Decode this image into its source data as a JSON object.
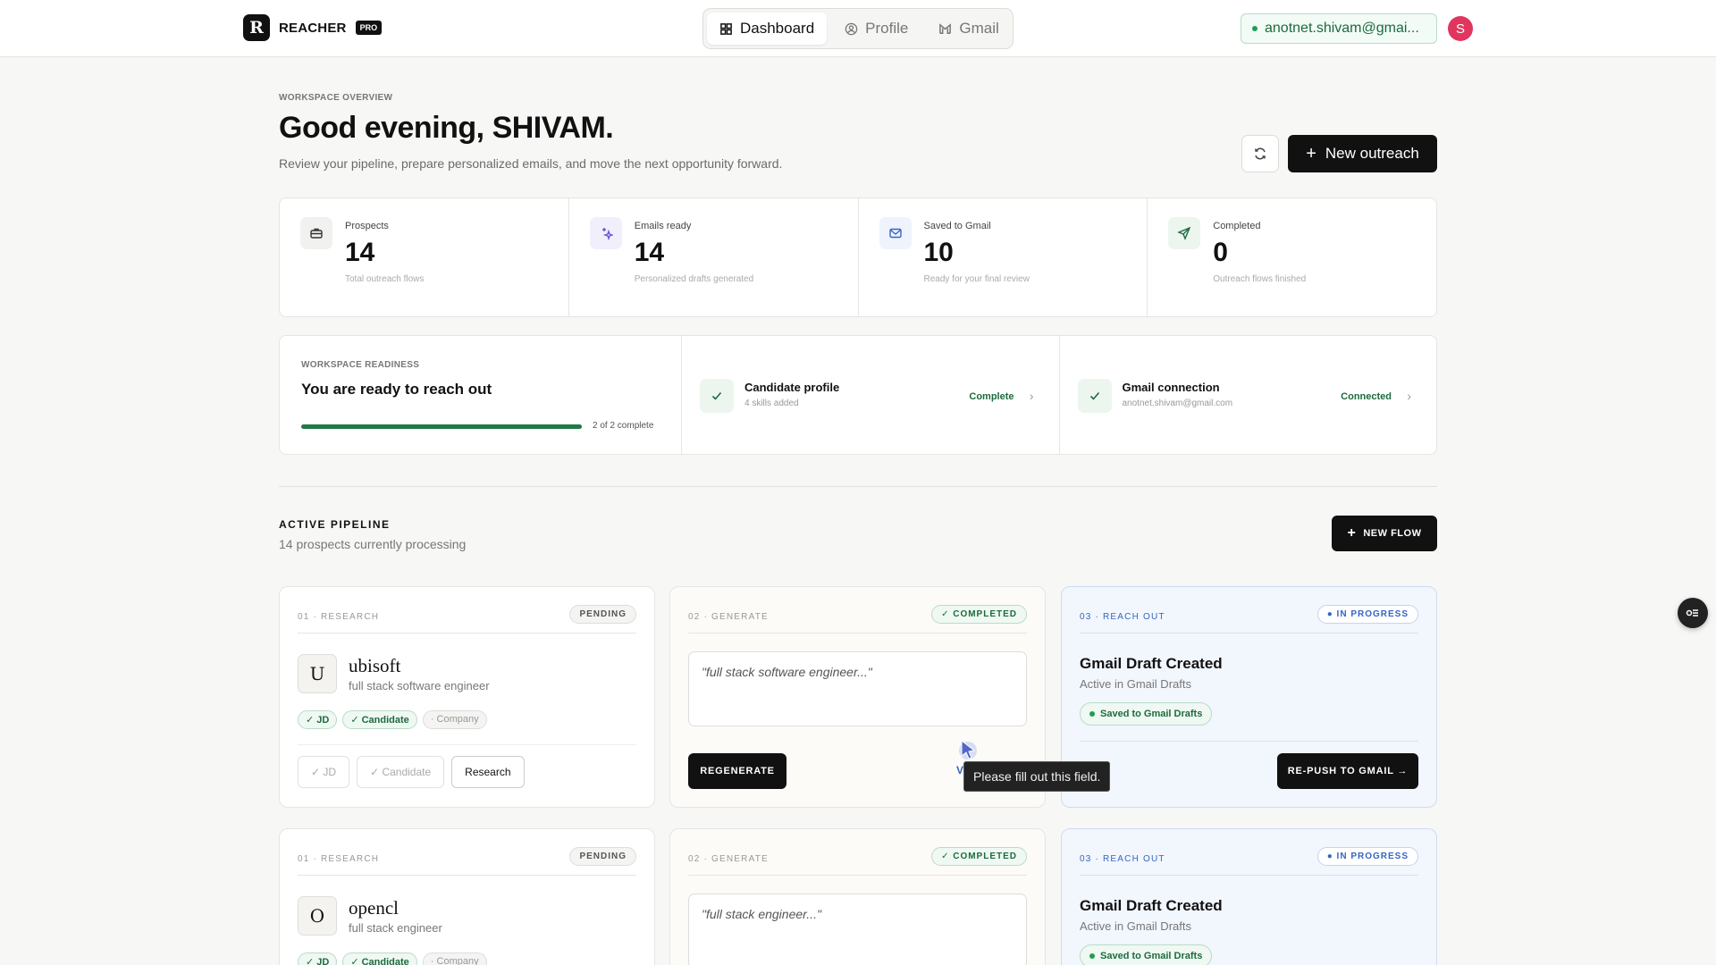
{
  "brand": {
    "logo_letter": "R",
    "name": "REACHER",
    "tier": "PRO"
  },
  "nav": {
    "tabs": [
      {
        "label": "Dashboard",
        "icon": "grid-icon"
      },
      {
        "label": "Profile",
        "icon": "user-circle-icon"
      },
      {
        "label": "Gmail",
        "icon": "gmail-icon"
      }
    ]
  },
  "account": {
    "email": "anotnet.shivam@gmai...",
    "avatar": "S"
  },
  "header": {
    "eyebrow": "WORKSPACE OVERVIEW",
    "greeting": "Good evening, SHIVAM.",
    "subtitle": "Review your pipeline, prepare personalized emails, and move the next opportunity forward.",
    "new_outreach": "New outreach"
  },
  "stats": [
    {
      "label": "Prospects",
      "value": "14",
      "sub": "Total outreach flows",
      "icon": "briefcase-icon"
    },
    {
      "label": "Emails ready",
      "value": "14",
      "sub": "Personalized drafts generated",
      "icon": "sparkle-icon"
    },
    {
      "label": "Saved to Gmail",
      "value": "10",
      "sub": "Ready for your final review",
      "icon": "mail-icon"
    },
    {
      "label": "Completed",
      "value": "0",
      "sub": "Outreach flows finished",
      "icon": "send-icon"
    }
  ],
  "readiness": {
    "eyebrow": "WORKSPACE READINESS",
    "title": "You are ready to reach out",
    "progress_text": "2 of 2 complete",
    "progress": 1.0,
    "items": [
      {
        "title": "Candidate profile",
        "sub": "4 skills added",
        "status": "Complete"
      },
      {
        "title": "Gmail connection",
        "sub": "anotnet.shivam@gmail.com",
        "status": "Connected"
      }
    ]
  },
  "pipeline": {
    "title": "ACTIVE PIPELINE",
    "subtitle": "14 prospects currently processing",
    "new_flow": "NEW FLOW",
    "rows": [
      {
        "research": {
          "step": "01 · RESEARCH",
          "badge": "PENDING",
          "initial": "U",
          "company": "ubisoft",
          "role": "full stack software engineer",
          "chips": [
            "✓ JD",
            "✓ Candidate",
            "· Company"
          ],
          "actions": [
            "✓ JD",
            "✓ Candidate",
            "Research"
          ]
        },
        "generate": {
          "step": "02 · GENERATE",
          "badge": "✓ COMPLETED",
          "quote": "\"full stack software engineer...\"",
          "regenerate": "REGENERATE",
          "view": "V"
        },
        "reach": {
          "step": "03 · REACH OUT",
          "badge": "● IN PROGRESS",
          "title": "Gmail Draft Created",
          "sub": "Active in Gmail Drafts",
          "pill": "Saved to Gmail Drafts",
          "repush": "RE-PUSH TO GMAIL →"
        }
      },
      {
        "research": {
          "step": "01 · RESEARCH",
          "badge": "PENDING",
          "initial": "O",
          "company": "opencl",
          "role": "full stack engineer",
          "chips": [
            "✓ JD",
            "✓ Candidate",
            "· Company"
          ]
        },
        "generate": {
          "step": "02 · GENERATE",
          "badge": "✓ COMPLETED",
          "quote": "\"full stack engineer...\""
        },
        "reach": {
          "step": "03 · REACH OUT",
          "badge": "● IN PROGRESS",
          "title": "Gmail Draft Created",
          "sub": "Active in Gmail Drafts",
          "pill": "Saved to Gmail Drafts"
        }
      }
    ]
  },
  "tooltip": "Please fill out this field.",
  "colors": {
    "accent": "#111111",
    "success": "#1f9d55",
    "info": "#3466c2",
    "avatar": "#e0365d"
  }
}
